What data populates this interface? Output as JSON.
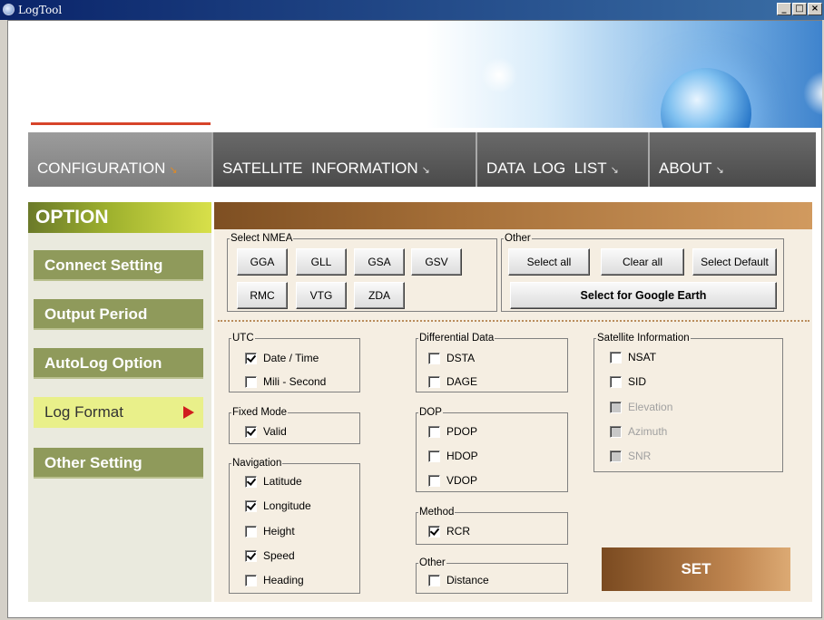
{
  "window": {
    "title": "LogTool",
    "minimize": "_",
    "maximize": "□",
    "close": "×"
  },
  "tabs": [
    {
      "label": "CONFIGURATION",
      "active": true
    },
    {
      "label": "SATELLITE  INFORMATION",
      "active": false
    },
    {
      "label": "DATA  LOG  LIST",
      "active": false
    },
    {
      "label": "ABOUT",
      "active": false
    }
  ],
  "tab_arrow": "↘",
  "sidebar": {
    "header": "OPTION",
    "items": [
      {
        "label": "Connect Setting",
        "active": false
      },
      {
        "label": "Output Period",
        "active": false
      },
      {
        "label": "AutoLog Option",
        "active": false
      },
      {
        "label": "Log Format",
        "active": true
      },
      {
        "label": "Other Setting",
        "active": false
      }
    ]
  },
  "select_nmea": {
    "legend": "Select NMEA",
    "buttons": [
      "GGA",
      "GLL",
      "GSA",
      "GSV",
      "RMC",
      "VTG",
      "ZDA"
    ]
  },
  "other_top": {
    "legend": "Other",
    "select_all": "Select all",
    "clear_all": "Clear all",
    "select_default": "Select Default",
    "google_earth": "Select for Google Earth"
  },
  "utc": {
    "legend": "UTC",
    "items": [
      {
        "label": "Date / Time",
        "checked": true
      },
      {
        "label": "Mili - Second",
        "checked": false
      }
    ]
  },
  "fixed_mode": {
    "legend": "Fixed Mode",
    "items": [
      {
        "label": "Valid",
        "checked": true
      }
    ]
  },
  "navigation": {
    "legend": "Navigation",
    "items": [
      {
        "label": "Latitude",
        "checked": true
      },
      {
        "label": "Longitude",
        "checked": true
      },
      {
        "label": "Height",
        "checked": false
      },
      {
        "label": "Speed",
        "checked": true
      },
      {
        "label": "Heading",
        "checked": false
      }
    ]
  },
  "differential": {
    "legend": "Differential Data",
    "items": [
      {
        "label": "DSTA",
        "checked": false
      },
      {
        "label": "DAGE",
        "checked": false
      }
    ]
  },
  "dop": {
    "legend": "DOP",
    "items": [
      {
        "label": "PDOP",
        "checked": false
      },
      {
        "label": "HDOP",
        "checked": false
      },
      {
        "label": "VDOP",
        "checked": false
      }
    ]
  },
  "method": {
    "legend": "Method",
    "items": [
      {
        "label": "RCR",
        "checked": true
      }
    ]
  },
  "other_bottom": {
    "legend": "Other",
    "items": [
      {
        "label": "Distance",
        "checked": false
      }
    ]
  },
  "satellite_info": {
    "legend": "Satellite Information",
    "items": [
      {
        "label": "NSAT",
        "checked": false,
        "disabled": false
      },
      {
        "label": "SID",
        "checked": false,
        "disabled": false
      },
      {
        "label": "Elevation",
        "checked": false,
        "disabled": true
      },
      {
        "label": "Azimuth",
        "checked": false,
        "disabled": true
      },
      {
        "label": "SNR",
        "checked": false,
        "disabled": true
      }
    ]
  },
  "set_button": "SET"
}
